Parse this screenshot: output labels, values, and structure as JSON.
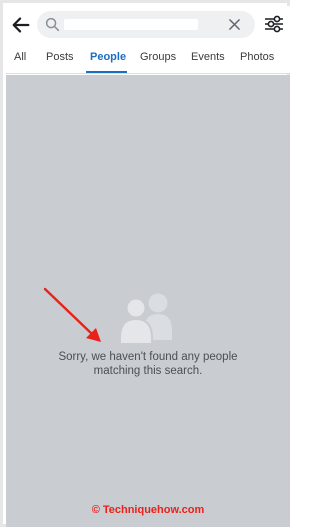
{
  "header": {
    "back_icon": "arrow-left-icon",
    "search": {
      "icon": "search-icon",
      "clear_icon": "close-icon"
    },
    "filter_icon": "sliders-icon"
  },
  "tabs": [
    {
      "label": "All",
      "active": false
    },
    {
      "label": "Posts",
      "active": false
    },
    {
      "label": "People",
      "active": true
    },
    {
      "label": "Groups",
      "active": false
    },
    {
      "label": "Events",
      "active": false
    },
    {
      "label": "Photos",
      "active": false
    }
  ],
  "empty_state": {
    "icon": "people-icon",
    "line1": "Sorry, we haven't found any people",
    "line2": "matching this search."
  },
  "annotation": {
    "icon": "red-arrow-icon"
  },
  "watermark": "© Techniquehow.com",
  "colors": {
    "accent": "#1b6ec2",
    "background": "#c9ccd1",
    "arrow": "#e8221b"
  }
}
